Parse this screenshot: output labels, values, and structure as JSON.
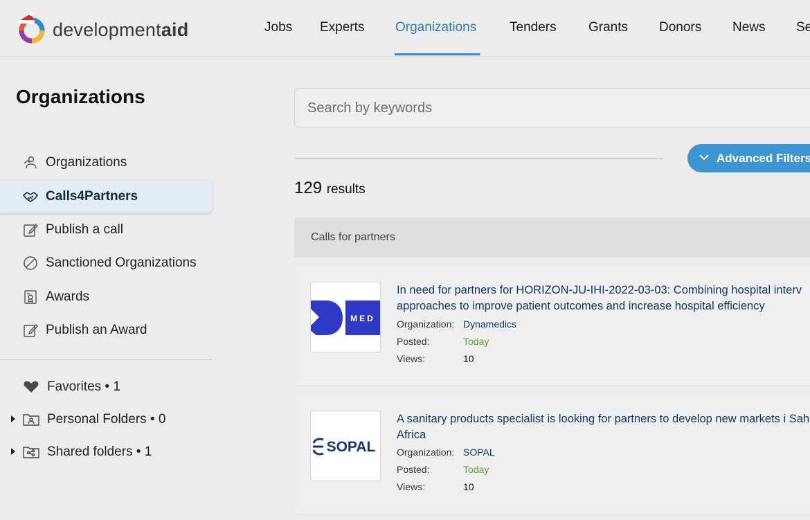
{
  "brand": {
    "name_part1": "development",
    "name_part2": "aid"
  },
  "nav": {
    "items": [
      {
        "label": "Jobs"
      },
      {
        "label": "Experts"
      },
      {
        "label": "Organizations",
        "active": true
      },
      {
        "label": "Tenders"
      },
      {
        "label": "Grants"
      },
      {
        "label": "Donors"
      },
      {
        "label": "News"
      },
      {
        "label": "Se"
      }
    ]
  },
  "sidebar": {
    "title": "Organizations",
    "items": [
      {
        "label": "Organizations",
        "icon": "organizations-icon"
      },
      {
        "label": "Calls4Partners",
        "icon": "handshake-icon",
        "active": true
      },
      {
        "label": "Publish a call",
        "icon": "edit-icon"
      },
      {
        "label": "Sanctioned Organizations",
        "icon": "ban-icon"
      },
      {
        "label": "Awards",
        "icon": "award-document-icon"
      },
      {
        "label": "Publish an Award",
        "icon": "edit-icon"
      }
    ],
    "folders": [
      {
        "label": "Favorites • 1",
        "icon": "heart-icon"
      },
      {
        "label": "Personal Folders • 0",
        "icon": "personal-folder-icon"
      },
      {
        "label": "Shared folders • 1",
        "icon": "shared-folder-icon"
      }
    ]
  },
  "search": {
    "placeholder": "Search by keywords"
  },
  "filters": {
    "advanced_label": "Advanced Filters"
  },
  "results": {
    "count": "129",
    "label": "results"
  },
  "section": {
    "title": "Calls for partners"
  },
  "labels": {
    "organization": "Organization:",
    "posted": "Posted:",
    "views": "Views:"
  },
  "cards": [
    {
      "title": "In need for partners for HORIZON-JU-IHI-2022-03-03: Combining hospital interv approaches to improve patient outcomes and increase hospital efficiency",
      "organization": "Dynamedics",
      "posted": "Today",
      "views": "10",
      "logo_text": "MED",
      "logo_letter": "D"
    },
    {
      "title": "A sanitary products specialist is looking for partners to develop new markets i Saharan Africa",
      "organization": "SOPAL",
      "posted": "Today",
      "views": "10",
      "logo_text": "SOPAL"
    }
  ],
  "colors": {
    "accent": "#2e8bd0",
    "button": "#3d96d2",
    "link": "#0e3a63",
    "today": "#5aa532"
  }
}
